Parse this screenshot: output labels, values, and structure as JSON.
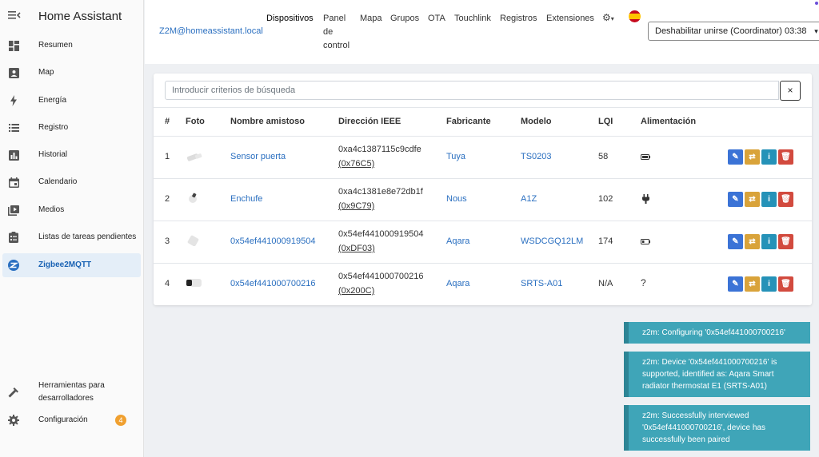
{
  "app": {
    "title": "Home Assistant"
  },
  "sidebar": {
    "items": [
      {
        "label": "Resumen",
        "icon": "dashboard-icon"
      },
      {
        "label": "Map",
        "icon": "map-icon"
      },
      {
        "label": "Energía",
        "icon": "lightning-icon"
      },
      {
        "label": "Registro",
        "icon": "list-icon"
      },
      {
        "label": "Historial",
        "icon": "chart-icon"
      },
      {
        "label": "Calendario",
        "icon": "calendar-icon"
      },
      {
        "label": "Medios",
        "icon": "media-icon"
      },
      {
        "label": "Listas de tareas pendientes",
        "icon": "clipboard-icon"
      },
      {
        "label": "Zigbee2MQTT",
        "icon": "zigbee-icon",
        "active": true
      }
    ],
    "dev_tools": {
      "label": "Herramientas para desarrolladores",
      "line1": "Herramientas para",
      "line2": "desarrolladores"
    },
    "settings": {
      "label": "Configuración",
      "badge": "4"
    }
  },
  "topnav": {
    "host": "Z2M@homeassistant.local",
    "links": [
      "Dispositivos",
      "Panel de control",
      "Mapa",
      "Grupos",
      "OTA",
      "Touchlink",
      "Registros",
      "Extensiones"
    ],
    "panel_lines": [
      "Panel",
      "de",
      "control"
    ],
    "permit_join": "Deshabilitar unirse (Coordinator) 03:38"
  },
  "devices": {
    "search_placeholder": "Introducir criterios de búsqueda",
    "clear_label": "×",
    "headers": [
      "#",
      "Foto",
      "Nombre amistoso",
      "Dirección IEEE",
      "Fabricante",
      "Modelo",
      "LQI",
      "Alimentación"
    ],
    "rows": [
      {
        "idx": "1",
        "name": "Sensor puerta",
        "ieee": "0xa4c1387115c9cdfe",
        "nwk": "(0x76C5)",
        "vendor": "Tuya",
        "model": "TS0203",
        "lqi": "58",
        "power": "battery-icon"
      },
      {
        "idx": "2",
        "name": "Enchufe",
        "ieee": "0xa4c1381e8e72db1f",
        "nwk": "(0x9C79)",
        "vendor": "Nous",
        "model": "A1Z",
        "lqi": "102",
        "power": "plug-icon"
      },
      {
        "idx": "3",
        "name": "0x54ef441000919504",
        "ieee": "0x54ef441000919504",
        "nwk": "(0xDF03)",
        "vendor": "Aqara",
        "model": "WSDCGQ12LM",
        "lqi": "174",
        "power": "battery-low-icon"
      },
      {
        "idx": "4",
        "name": "0x54ef441000700216",
        "ieee": "0x54ef441000700216",
        "nwk": "(0x200C)",
        "vendor": "Aqara",
        "model": "SRTS-A01",
        "lqi": "N/A",
        "power": "?"
      }
    ]
  },
  "toasts": [
    "z2m: Configuring '0x54ef441000700216'",
    "z2m: Device '0x54ef441000700216' is supported, identified as: Aqara Smart radiator thermostat E1 (SRTS-A01)",
    "z2m: Successfully interviewed '0x54ef441000700216', device has successfully been paired"
  ],
  "colors": {
    "accent": "#2a6fc0",
    "toast": "#3fa5b8",
    "edit": "#3b73d6",
    "rename": "#d9a33a",
    "info": "#2592b8",
    "delete": "#d24a3e"
  }
}
